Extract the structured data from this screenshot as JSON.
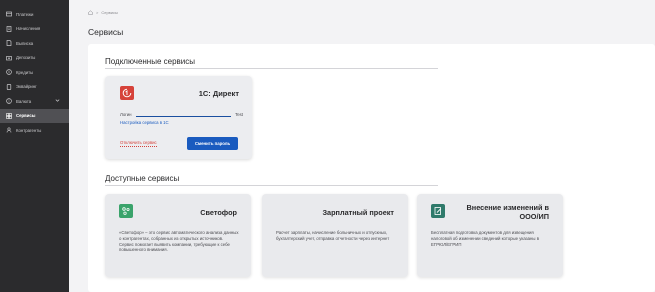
{
  "sidebar": {
    "items": [
      {
        "label": "Платежи",
        "icon": "payments-icon"
      },
      {
        "label": "Начисления",
        "icon": "accruals-icon"
      },
      {
        "label": "Выписка",
        "icon": "statement-icon"
      },
      {
        "label": "Депозиты",
        "icon": "deposits-icon"
      },
      {
        "label": "Кредиты",
        "icon": "credits-icon"
      },
      {
        "label": "Эквайринг",
        "icon": "acquiring-icon"
      },
      {
        "label": "Валюта",
        "icon": "currency-icon"
      },
      {
        "label": "Сервисы",
        "icon": "services-icon"
      },
      {
        "label": "Контрагенты",
        "icon": "counterparties-icon"
      }
    ]
  },
  "breadcrumb": {
    "current": "Сервисы"
  },
  "page": {
    "title": "Сервисы"
  },
  "connected": {
    "section_title": "Подключенные сервисы",
    "service": {
      "name": "1С: Директ",
      "login_label": "Логин",
      "login_value": "Test",
      "settings_link": "Настройка сервиса в 1С",
      "disconnect_link": "Отключить сервис",
      "change_password_button": "Сменить пароль",
      "logo_color": "#d6423a"
    }
  },
  "available": {
    "section_title": "Доступные сервисы",
    "services": [
      {
        "name": "Светофор",
        "description": "«Светофор» – это сервис автоматического анализа данных о контрагентах, собранных из открытых источников. Сервис помогает выявить компании, требующие к себе повышенного внимания.",
        "logo_color": "#3aa36b"
      },
      {
        "name": "Зарплатный проект",
        "description": "Расчет зарплаты, начисление больничных и отпускных, бухгалтерский учет, отправка отчетности через интернет"
      },
      {
        "name_line1": "Внесение изменений в",
        "name_line2": "ООО/ИП",
        "description": "Бесплатная подготовка документов для извещения налоговой об изменении сведений которые указаны в ЕГРЮЛ/ЕГРИП",
        "logo_color": "#2f7a6b"
      }
    ]
  },
  "colors": {
    "accent": "#1a5bbf",
    "danger": "#d6423a",
    "sidebar": "#2b2b2d"
  }
}
